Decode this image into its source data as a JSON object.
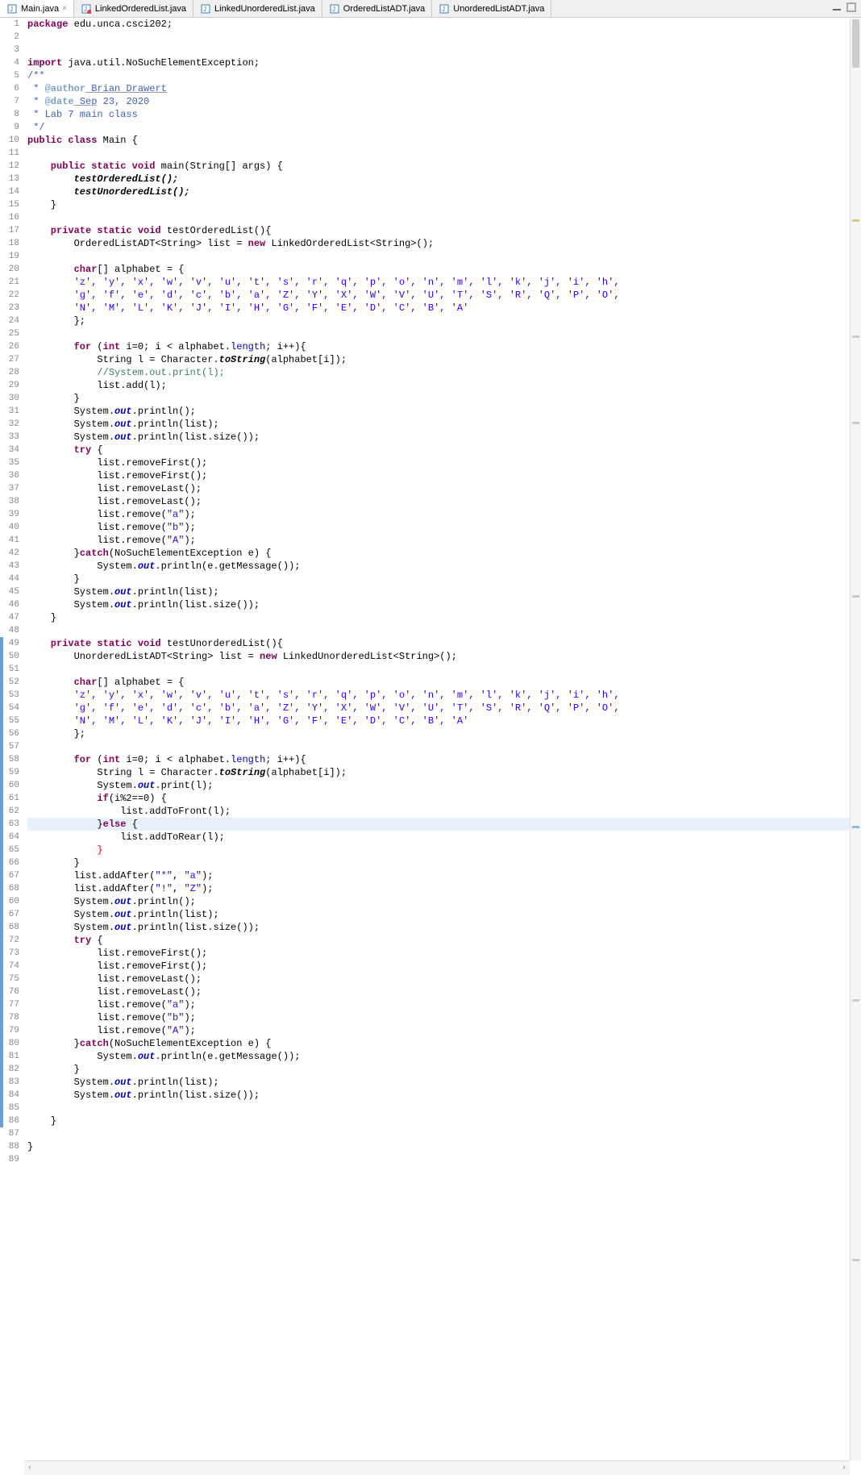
{
  "tabs": [
    {
      "label": "Main.java",
      "active": true,
      "icon": "java"
    },
    {
      "label": "LinkedOrderedList.java",
      "active": false,
      "icon": "java-err"
    },
    {
      "label": "LinkedUnorderedList.java",
      "active": false,
      "icon": "java"
    },
    {
      "label": "OrderedListADT.java",
      "active": false,
      "icon": "java"
    },
    {
      "label": "UnorderedListADT.java",
      "active": false,
      "icon": "java"
    }
  ],
  "line_numbers": [
    "1",
    "2",
    "3",
    "4",
    "5",
    "6",
    "7",
    "8",
    "9",
    "10",
    "11",
    "12",
    "13",
    "14",
    "15",
    "16",
    "17",
    "18",
    "19",
    "20",
    "21",
    "22",
    "23",
    "24",
    "25",
    "26",
    "27",
    "28",
    "29",
    "30",
    "31",
    "32",
    "33",
    "34",
    "35",
    "36",
    "37",
    "38",
    "39",
    "40",
    "41",
    "42",
    "43",
    "44",
    "45",
    "46",
    "47",
    "48",
    "49",
    "50",
    "51",
    "52",
    "53",
    "54",
    "55",
    "56",
    "57",
    "58",
    "59",
    "60",
    "61",
    "62",
    "63",
    "64",
    "65",
    "66",
    "67",
    "68",
    "60",
    "67",
    "68",
    "72",
    "73",
    "74",
    "75",
    "76",
    "77",
    "78",
    "79",
    "80",
    "81",
    "82",
    "83",
    "84",
    "85",
    "86",
    "87",
    "88",
    "89"
  ],
  "code": {
    "l1_package": "package",
    "l1_pkg": " edu.unca.csci202;",
    "l4_import": "import",
    "l4_rest": " java.util.NoSuchElementException;",
    "l5": "/**",
    "l6_pre": " * ",
    "l6_tag": "@author",
    "l6_u1": " Brian",
    "l6_u2": " Drawert",
    "l7_pre": " * ",
    "l7_tag": "@date",
    "l7_u1": " Sep",
    "l7_rest": " 23, 2020",
    "l8": " * Lab 7 main class",
    "l9": " */",
    "l10_kw": "public class",
    "l10_rest": " Main {",
    "l12_kw": "    public static void",
    "l12_rest": " main(String[] args) {",
    "l13": "        testOrderedList();",
    "l14": "        testUnorderedList();",
    "l15": "    }",
    "l17_kw": "    private static void",
    "l17_rest": " testOrderedList(){",
    "l18a": "        OrderedListADT<String> list = ",
    "l18_new": "new",
    "l18b": " LinkedOrderedList<String>();",
    "l20_kw": "        char",
    "l20_rest": "[] alphabet = {",
    "l21": "        'z', 'y', 'x', 'w', 'v', 'u', 't', 's', 'r', 'q', 'p', 'o', 'n', 'm', 'l', 'k', 'j', 'i', 'h',",
    "l22": "        'g', 'f', 'e', 'd', 'c', 'b', 'a', 'Z', 'Y', 'X', 'W', 'V', 'U', 'T', 'S', 'R', 'Q', 'P', 'O',",
    "l23": "        'N', 'M', 'L', 'K', 'J', 'I', 'H', 'G', 'F', 'E', 'D', 'C', 'B', 'A'",
    "l24": "        };",
    "l26_for": "        for",
    "l26a": " (",
    "l26_int": "int",
    "l26b": " i=0; i < alphabet.",
    "l26_len": "length",
    "l26c": "; i++){",
    "l27a": "            String l = Character.",
    "l27_ts": "toString",
    "l27b": "(alphabet[i]);",
    "l28": "            //System.out.print(l);",
    "l29": "            list.add(l);",
    "l30": "        }",
    "l31a": "        System.",
    "l31_out": "out",
    "l31b": ".println();",
    "l32b": ".println(list);",
    "l33b": ".println(list.size());",
    "l34_try": "        try",
    "l34_rest": " {",
    "l35": "            list.removeFirst();",
    "l36": "            list.removeFirst();",
    "l37": "            list.removeLast();",
    "l38": "            list.removeLast();",
    "l39a": "            list.remove(",
    "l39s": "\"a\"",
    "l39b": ");",
    "l40s": "\"b\"",
    "l41s": "\"A\"",
    "l42a": "        }",
    "l42_catch": "catch",
    "l42b": "(NoSuchElementException e) {",
    "l43a": "            System.",
    "l43b": ".println(e.getMessage());",
    "l44": "        }",
    "l47": "    }",
    "l49_kw": "    private static void",
    "l49_rest": " testUnorderedList(){",
    "l50a": "        UnorderedListADT<String> list = ",
    "l50b": " LinkedUnorderedList<String>();",
    "l59a": "            String l = Character.",
    "l59b": "(alphabet[i]);",
    "l60a": "            System.",
    "l60b": ".print(l);",
    "l61_if": "            if",
    "l61_rest": "(i%2==0) {",
    "l62": "                list.addToFront(l);",
    "l63a": "            }",
    "l63_else": "else",
    "l63b": " {",
    "l64": "                list.addToRear(l);",
    "l65": "            }",
    "l65_brace": "}",
    "l66": "        }",
    "l67a": "        list.addAfter(",
    "l67s1": "\"*\"",
    "l67c": ", ",
    "l67s2": "\"a\"",
    "l67b": ");",
    "l68s1": "\"!\"",
    "l68s2": "\"Z\"",
    "l86": "    }",
    "l88": "}"
  }
}
